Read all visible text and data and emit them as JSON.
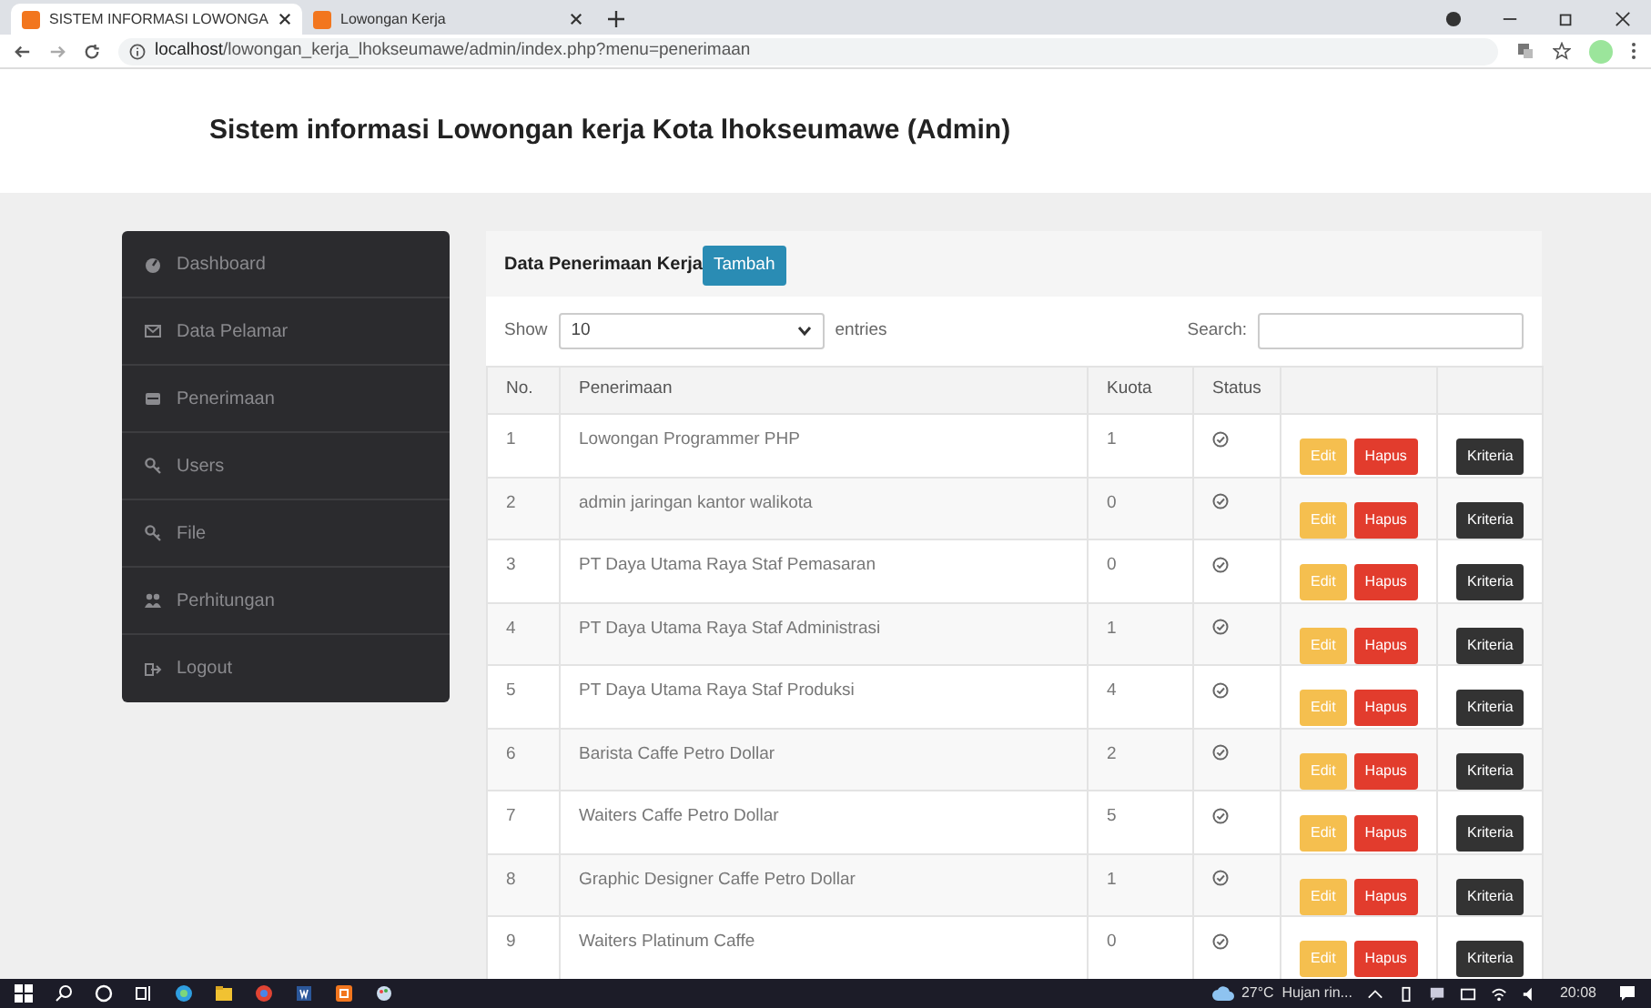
{
  "browser": {
    "tabs": [
      {
        "title": "SISTEM INFORMASI LOWONGA",
        "selected": true
      },
      {
        "title": "Lowongan Kerja",
        "selected": false
      }
    ],
    "url_host": "localhost",
    "url_path": "/lowongan_kerja_lhokseumawe/admin/index.php?menu=penerimaan"
  },
  "page_title": "Sistem informasi Lowongan kerja Kota lhokseumawe (Admin)",
  "sidebar": {
    "items": [
      {
        "label": "Dashboard"
      },
      {
        "label": "Data Pelamar"
      },
      {
        "label": "Penerimaan"
      },
      {
        "label": "Users"
      },
      {
        "label": "File"
      },
      {
        "label": "Perhitungan"
      },
      {
        "label": "Logout"
      }
    ]
  },
  "card": {
    "title": "Data Penerimaan Kerja",
    "add_button": "Tambah",
    "show_label": "Show",
    "entries_value": "10",
    "entries_label": "entries",
    "search_label": "Search:"
  },
  "table": {
    "columns": [
      "No.",
      "Penerimaan",
      "Kuota",
      "Status"
    ],
    "rows": [
      {
        "no": "1",
        "name": "Lowongan Programmer PHP",
        "quota": "1",
        "edit": "Edit",
        "delete": "Hapus",
        "criteria": "Kriteria"
      },
      {
        "no": "2",
        "name": "admin jaringan kantor walikota",
        "quota": "0",
        "edit": "Edit",
        "delete": "Hapus",
        "criteria": "Kriteria"
      },
      {
        "no": "3",
        "name": "PT Daya Utama Raya Staf Pemasaran",
        "quota": "0",
        "edit": "Edit",
        "delete": "Hapus",
        "criteria": "Kriteria"
      },
      {
        "no": "4",
        "name": "PT Daya Utama Raya Staf Administrasi",
        "quota": "1",
        "edit": "Edit",
        "delete": "Hapus",
        "criteria": "Kriteria"
      },
      {
        "no": "5",
        "name": "PT Daya Utama Raya Staf Produksi",
        "quota": "4",
        "edit": "Edit",
        "delete": "Hapus",
        "criteria": "Kriteria"
      },
      {
        "no": "6",
        "name": "Barista Caffe Petro Dollar",
        "quota": "2",
        "edit": "Edit",
        "delete": "Hapus",
        "criteria": "Kriteria"
      },
      {
        "no": "7",
        "name": "Waiters Caffe Petro Dollar",
        "quota": "5",
        "edit": "Edit",
        "delete": "Hapus",
        "criteria": "Kriteria"
      },
      {
        "no": "8",
        "name": "Graphic Designer Caffe Petro Dollar",
        "quota": "1",
        "edit": "Edit",
        "delete": "Hapus",
        "criteria": "Kriteria"
      },
      {
        "no": "9",
        "name": "Waiters Platinum Caffe",
        "quota": "0",
        "edit": "Edit",
        "delete": "Hapus",
        "criteria": "Kriteria"
      }
    ]
  },
  "taskbar": {
    "weather": "27°C  Hujan rin...",
    "clock": "20:08"
  }
}
